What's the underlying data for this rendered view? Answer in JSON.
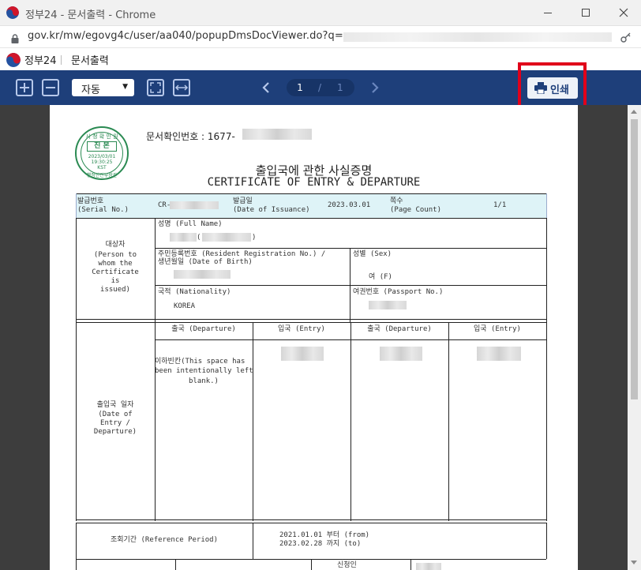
{
  "window": {
    "title": "정부24 - 문서출력 - Chrome",
    "controls": [
      "minimize-icon",
      "maximize-icon",
      "close-icon"
    ]
  },
  "address_bar": {
    "url": "gov.kr/mw/egovg4c/user/aa040/popupDmsDocViewer.do?q="
  },
  "app_header": {
    "brand": "정부24",
    "page": "문서출력"
  },
  "toolbar": {
    "zoom_in_icon": "plus-icon",
    "zoom_out_icon": "minus-icon",
    "zoom_value": "자동",
    "page_current": "1",
    "page_separator": "/",
    "page_total": "1",
    "print_label": "인쇄",
    "colors": {
      "bar": "#1e3f7a",
      "highlight": "#e0001a"
    }
  },
  "document": {
    "doc_no_label": "문서확인번호 : 1677-",
    "seal": {
      "top": "시 청 확 인 원",
      "center": "진 본",
      "date": "2023/03/01",
      "time": "19:30:25",
      "tz": "KST",
      "bottom": "행정안전부장관"
    },
    "title_ko": "출입국에 관한 사실증명",
    "title_en": "CERTIFICATE OF ENTRY & DEPARTURE",
    "serial_label_ko": "발급번호",
    "serial_label_en": "(Serial No.)",
    "serial_value": "CR-",
    "issue_label_ko": "발급일",
    "issue_label_en": "(Date of Issuance)",
    "issue_value": "2023.03.01",
    "page_label_ko": "쪽수",
    "page_label_en": "(Page Count)",
    "page_value": "1/1",
    "person_ko": "대상자",
    "person_en_1": "(Person to",
    "person_en_2": "whom the",
    "person_en_3": "Certificate",
    "person_en_4": "is",
    "person_en_5": "issued)",
    "fullname_label": "성명 (Full Name)",
    "fullname_paren_open": "(",
    "fullname_paren_close": ")",
    "rrn_label_1": "주민등록번호 (Resident Registration No.) /",
    "rrn_label_2": "생년월일 (Date of Birth)",
    "sex_label": "성별 (Sex)",
    "sex_value": "여 (F)",
    "nationality_label": "국적 (Nationality)",
    "nationality_value": "KOREA",
    "passport_label": "여권번호 (Passport No.)",
    "dep_header_1": "출국 (Departure)",
    "entry_header_1": "입국 (Entry)",
    "dep_header_2": "출국 (Departure)",
    "entry_header_2": "입국 (Entry)",
    "blank_note_1": "이하빈칸(This space has",
    "blank_note_2": "been intentionally left",
    "blank_note_3": "blank.)",
    "dates_ko": "출입국 일자",
    "dates_en_1": "(Date of",
    "dates_en_2": "Entry /",
    "dates_en_3": "Departure)",
    "ref_label": "조회기간 (Reference Period)",
    "ref_from": "2021.01.01 부터 (from)",
    "ref_to": "2023.02.28 까지 (to)",
    "applicant_label": "신청인"
  }
}
